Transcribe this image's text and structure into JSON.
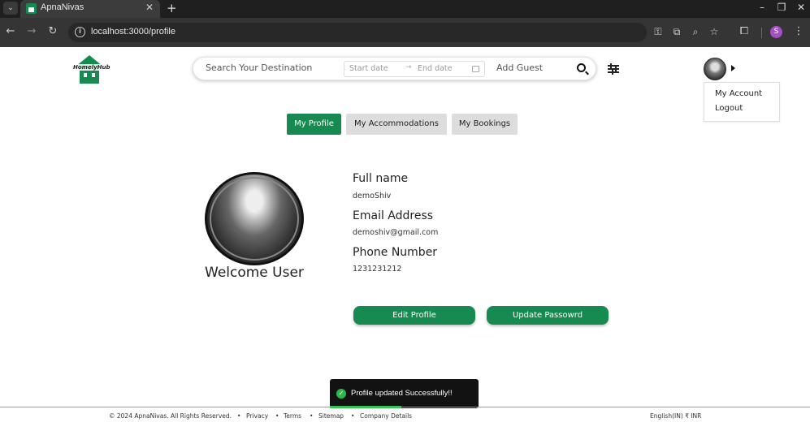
{
  "browser": {
    "tab_title": "ApnaNivas",
    "url": "localhost:3000/profile",
    "profile_initial": "S",
    "icons": [
      "tab-list-icon",
      "close-icon",
      "new-tab-icon",
      "minimize-icon",
      "restore-icon",
      "close-window-icon",
      "back-icon",
      "forward-icon",
      "reload-icon",
      "site-info-icon",
      "password-key-icon",
      "install-app-icon",
      "zoom-icon",
      "bookmark-star-icon",
      "extensions-icon",
      "more-menu-icon"
    ]
  },
  "header": {
    "logo_text": "HomelyHub",
    "search": {
      "destination_placeholder": "Search Your Destination",
      "start_date_placeholder": "Start date",
      "end_date_placeholder": "End date",
      "guest_placeholder": "Add Guest"
    },
    "dropdown": {
      "items": [
        {
          "label": "My Account"
        },
        {
          "label": "Logout"
        }
      ]
    }
  },
  "profile_tabs": [
    {
      "label": "My Profile",
      "active": true
    },
    {
      "label": "My Accommodations",
      "active": false
    },
    {
      "label": "My Bookings",
      "active": false
    }
  ],
  "profile": {
    "welcome": "Welcome User",
    "fields": [
      {
        "label": "Full name",
        "value": "demoShiv"
      },
      {
        "label": "Email Address",
        "value": "demoshiv@gmail.com"
      },
      {
        "label": "Phone Number",
        "value": "1231231212"
      }
    ],
    "edit_button": "Edit Profile",
    "password_button": "Update Passowrd"
  },
  "toast": {
    "message": "Profile updated Successfully!!",
    "status": "success"
  },
  "footer": {
    "copyright": "© 2024 ApnaNivas. All Rights Reserved.",
    "links": [
      {
        "label": "Privacy"
      },
      {
        "label": "Terms"
      },
      {
        "label": "Sitemap"
      },
      {
        "label": "Company Details"
      }
    ],
    "locale": "English(IN) ₹ INR"
  },
  "colors": {
    "brand_green": "#178a51",
    "toast_success": "#2cb84a",
    "tab_inactive": "#dddddd"
  }
}
